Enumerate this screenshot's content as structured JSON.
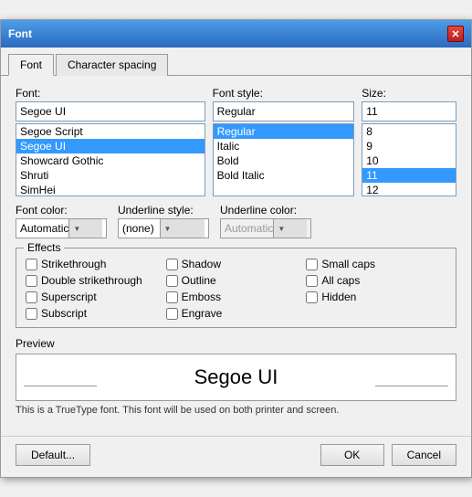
{
  "dialog": {
    "title": "Font",
    "close_button": "✕"
  },
  "tabs": [
    {
      "id": "font",
      "label": "Font",
      "active": true
    },
    {
      "id": "character_spacing",
      "label": "Character spacing",
      "active": false
    }
  ],
  "font_section": {
    "font_label": "Font:",
    "font_input_value": "Segoe UI",
    "font_list": [
      {
        "text": "Segoe Script",
        "selected": false
      },
      {
        "text": "Segoe UI",
        "selected": true
      },
      {
        "text": "Showcard Gothic",
        "selected": false
      },
      {
        "text": "Shruti",
        "selected": false
      },
      {
        "text": "SimHei",
        "selected": false
      }
    ],
    "style_label": "Font style:",
    "style_input_value": "Regular",
    "style_list": [
      {
        "text": "Regular",
        "selected": true
      },
      {
        "text": "Italic",
        "selected": false
      },
      {
        "text": "Bold",
        "selected": false
      },
      {
        "text": "Bold Italic",
        "selected": false
      }
    ],
    "size_label": "Size:",
    "size_input_value": "11",
    "size_list": [
      {
        "text": "8",
        "selected": false
      },
      {
        "text": "9",
        "selected": false
      },
      {
        "text": "10",
        "selected": false
      },
      {
        "text": "11",
        "selected": true
      },
      {
        "text": "12",
        "selected": false
      }
    ]
  },
  "controls": {
    "font_color_label": "Font color:",
    "font_color_value": "Automatic",
    "underline_style_label": "Underline style:",
    "underline_style_value": "(none)",
    "underline_color_label": "Underline color:",
    "underline_color_value": "Automatic",
    "underline_color_disabled": true
  },
  "effects": {
    "section_label": "Effects",
    "items": [
      {
        "id": "strikethrough",
        "label": "Strikethrough",
        "checked": false
      },
      {
        "id": "shadow",
        "label": "Shadow",
        "checked": false
      },
      {
        "id": "small_caps",
        "label": "Small caps",
        "checked": false
      },
      {
        "id": "double_strikethrough",
        "label": "Double strikethrough",
        "checked": false
      },
      {
        "id": "outline",
        "label": "Outline",
        "checked": false
      },
      {
        "id": "all_caps",
        "label": "All caps",
        "checked": false
      },
      {
        "id": "superscript",
        "label": "Superscript",
        "checked": false
      },
      {
        "id": "emboss",
        "label": "Emboss",
        "checked": false
      },
      {
        "id": "hidden",
        "label": "Hidden",
        "checked": false
      },
      {
        "id": "subscript",
        "label": "Subscript",
        "checked": false
      },
      {
        "id": "engrave",
        "label": "Engrave",
        "checked": false
      }
    ]
  },
  "preview": {
    "label": "Preview",
    "font_preview_text": "Segoe UI"
  },
  "info": {
    "text": "This is a TrueType font. This font will be used on both printer and screen."
  },
  "footer": {
    "default_label": "Default...",
    "ok_label": "OK",
    "cancel_label": "Cancel"
  }
}
